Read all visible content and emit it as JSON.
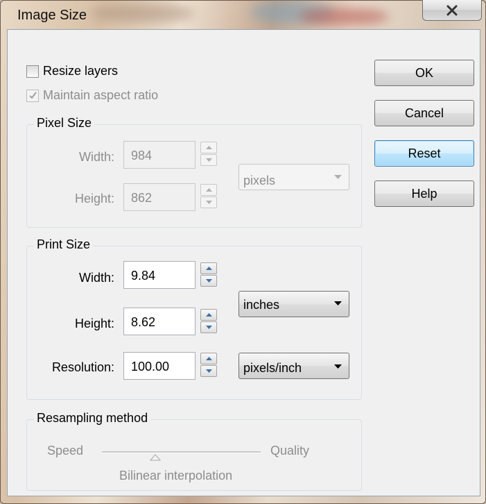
{
  "window": {
    "title": "Image Size"
  },
  "options": {
    "resize_layers": {
      "label": "Resize layers",
      "checked": false,
      "enabled": true
    },
    "maintain_aspect": {
      "label": "Maintain aspect ratio",
      "checked": true,
      "enabled": false
    }
  },
  "pixel_size": {
    "title": "Pixel Size",
    "width_label": "Width:",
    "width_value": "984",
    "height_label": "Height:",
    "height_value": "862",
    "unit": "pixels"
  },
  "print_size": {
    "title": "Print Size",
    "width_label": "Width:",
    "width_value": "9.84",
    "height_label": "Height:",
    "height_value": "8.62",
    "unit": "inches",
    "resolution_label": "Resolution:",
    "resolution_value": "100.00",
    "resolution_unit": "pixels/inch"
  },
  "resampling": {
    "title": "Resampling method",
    "left_label": "Speed",
    "right_label": "Quality",
    "method": "Bilinear interpolation"
  },
  "buttons": {
    "ok": "OK",
    "cancel": "Cancel",
    "reset": "Reset",
    "help": "Help"
  },
  "icons": {
    "close": "close-icon",
    "spin_up": "chevron-up-icon",
    "spin_down": "chevron-down-icon",
    "dropdown": "dropdown-arrow-icon"
  }
}
